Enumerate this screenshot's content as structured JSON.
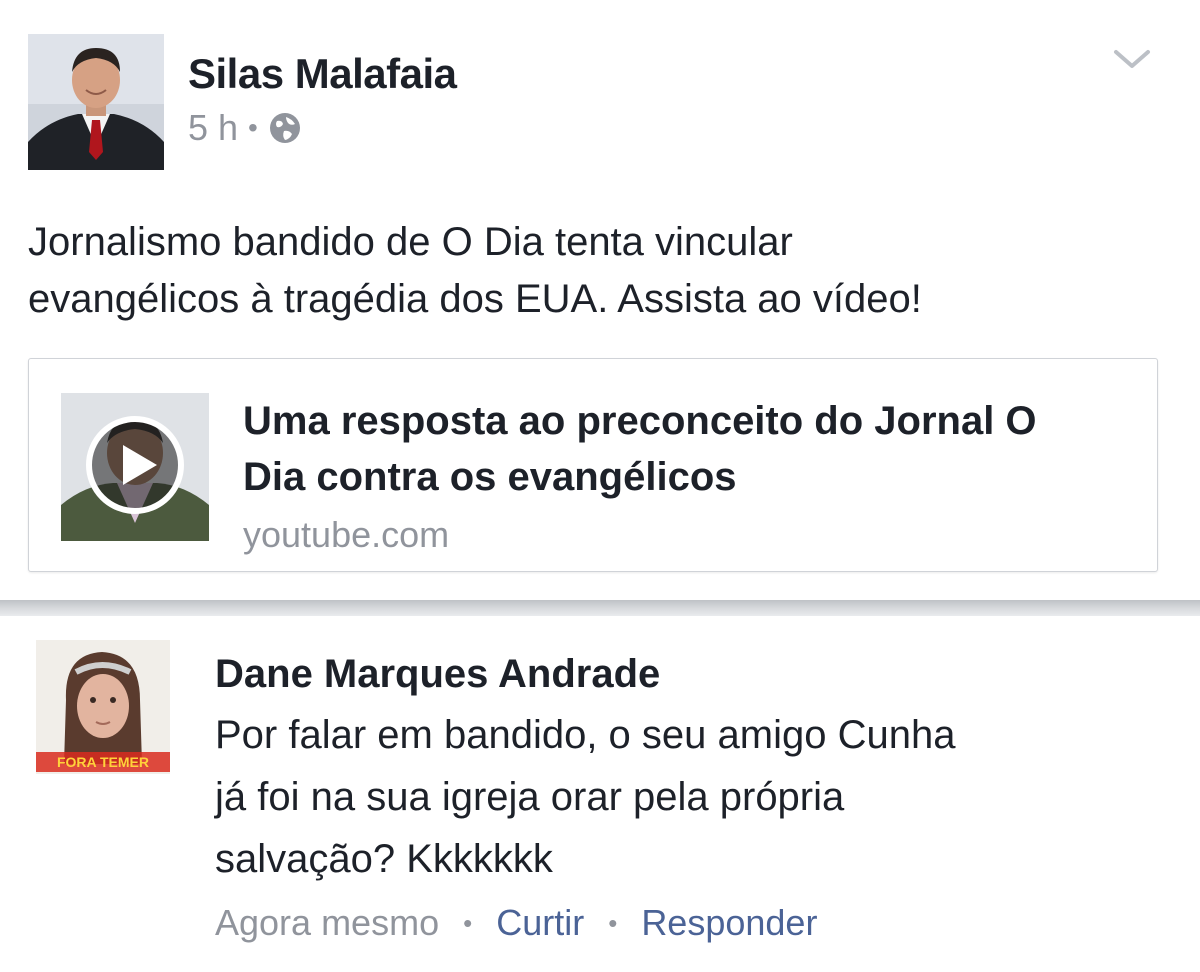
{
  "post": {
    "author": "Silas Malafaia",
    "time": "5 h",
    "separator": "•",
    "visibility_icon": "globe-icon",
    "menu_icon": "chevron-down-icon",
    "text_line1": "Jornalismo bandido de O Dia tenta vincular",
    "text_line2": "evangélicos à tragédia dos EUA. Assista ao vídeo!",
    "link": {
      "title_line1": "Uma resposta ao preconceito do Jornal O",
      "title_line2": "Dia contra os evangélicos",
      "domain": "youtube.com",
      "thumb_icon": "play-icon"
    }
  },
  "comment": {
    "author": "Dane Marques Andrade",
    "text_line1": "Por falar em bandido, o seu amigo Cunha",
    "text_line2": "já foi na sua igreja orar pela própria",
    "text_line3": "salvação? Kkkkkkk",
    "avatar_banner": "FORA TEMER",
    "time": "Agora mesmo",
    "separator": "•",
    "like_label": "Curtir",
    "reply_label": "Responder"
  },
  "colors": {
    "text": "#1d2129",
    "meta": "#90949c",
    "action_link": "#4b6396",
    "divider": "#d7d9dc"
  }
}
